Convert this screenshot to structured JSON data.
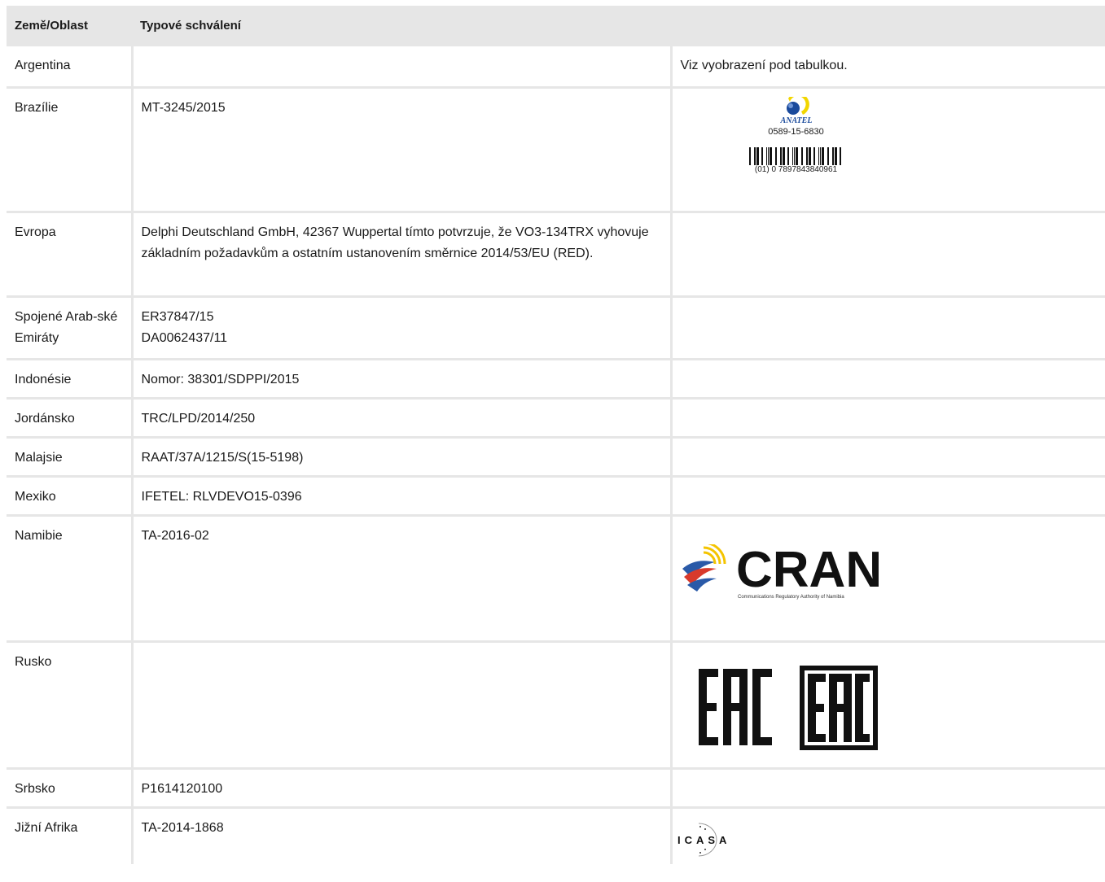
{
  "header": {
    "col1": "Země/Oblast",
    "col2": "Typové schválení"
  },
  "rows": [
    {
      "country": "Argentina",
      "approval": "",
      "note": "Viz vyobrazení pod tabulkou."
    },
    {
      "country": "Brazílie",
      "approval": "MT-3245/2015",
      "anatel": {
        "brand": "ANATEL",
        "number": "0589-15-6830",
        "barcode": "(01) 0 7897843840961"
      }
    },
    {
      "country": "Evropa",
      "approval": "Delphi Deutschland GmbH, 42367 Wuppertal tímto potvrzuje, že VO3-134TRX vyhovuje základním požadavkům a ostatním ustanovením směrnice 2014/53/EU (RED)."
    },
    {
      "country": "Spojené Arab-ské Emiráty",
      "approval_lines": [
        "ER37847/15",
        "DA0062437/11"
      ]
    },
    {
      "country": "Indonésie",
      "approval": "Nomor: 38301/SDPPI/2015"
    },
    {
      "country": "Jordánsko",
      "approval": "TRC/LPD/2014/250"
    },
    {
      "country": "Malajsie",
      "approval": "RAAT/37A/1215/S(15-5198)"
    },
    {
      "country": "Mexiko",
      "approval": "IFETEL: RLVDEVO15-0396"
    },
    {
      "country": "Namibie",
      "approval": "TA-2016-02",
      "cran": {
        "wordmark": "CRAN",
        "tagline": "Communications Regulatory Authority of Namibia"
      }
    },
    {
      "country": "Rusko",
      "approval": "",
      "eac": {
        "mark": "EAC"
      }
    },
    {
      "country": "Srbsko",
      "approval": "P1614120100"
    },
    {
      "country": "Jižní Afrika",
      "approval": "TA-2014-1868",
      "icasa": {
        "wordmark": "ICASA"
      }
    }
  ],
  "colors": {
    "grid": "#e6e6e6",
    "header_bg": "#e6e6e6",
    "anatel_blue": "#1a4a9c",
    "anatel_yellow": "#f2d600",
    "cran_text": "#111111",
    "cran_red": "#d83a2c",
    "cran_blue": "#2a5aa8",
    "cran_yellow": "#f4c400"
  }
}
